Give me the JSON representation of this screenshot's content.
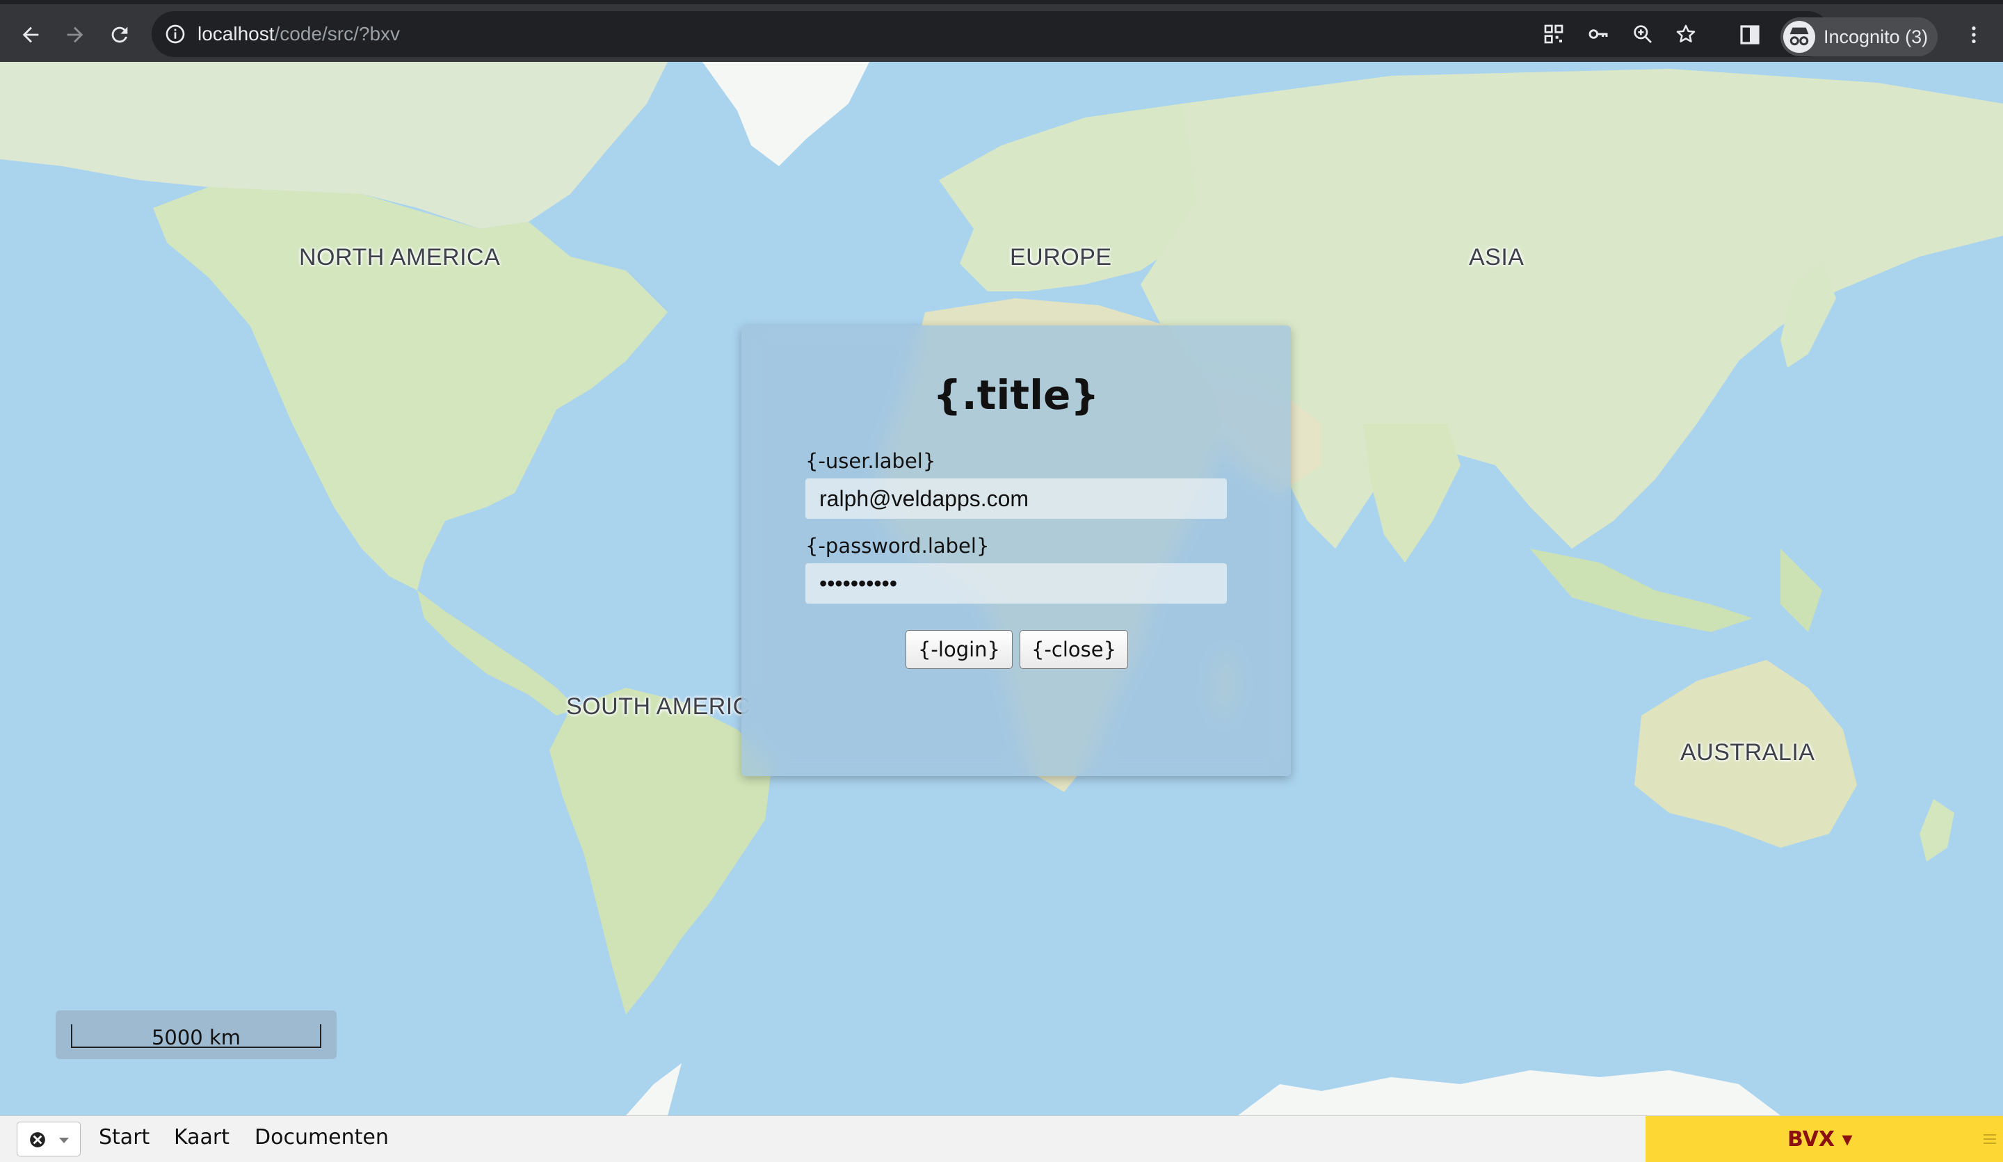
{
  "browser": {
    "url_host": "localhost",
    "url_path": "/code/src/?bxv",
    "profile_label": "Incognito (3)"
  },
  "map": {
    "labels": {
      "north_america": "NORTH AMERICA",
      "europe": "EUROPE",
      "asia": "ASIA",
      "south_america": "SOUTH AMERIC",
      "australia": "AUSTRALIA"
    },
    "scale_label": "5000 km"
  },
  "login_dialog": {
    "title": "{.title}",
    "user_label": "{-user.label}",
    "user_value": "ralph@veldapps.com",
    "password_label": "{-password.label}",
    "password_value": "password12",
    "login_button": "{-login}",
    "close_button": "{-close}"
  },
  "bottom_bar": {
    "tabs": [
      "Start",
      "Kaart",
      "Documenten"
    ],
    "app_button": "BVX ▾"
  },
  "colors": {
    "ocean": "#aad3ee",
    "land": "#d8e8c4",
    "accent_yellow": "#fdd835",
    "accent_text": "#8b1010"
  }
}
